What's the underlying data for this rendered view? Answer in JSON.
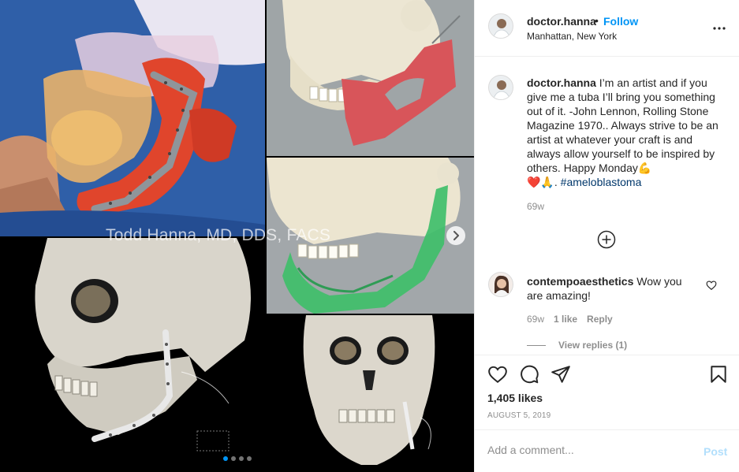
{
  "post": {
    "watermark": "Todd Hanna, MD, DDS, FACS",
    "carousel": {
      "slides": 4,
      "active": 1
    }
  },
  "header": {
    "username": "doctor.hanna",
    "separator": "•",
    "follow_label": "Follow",
    "location": "Manhattan, New York",
    "more_icon": "more-horizontal-icon"
  },
  "caption": {
    "username": "doctor.hanna",
    "text": " I’m an artist and if you give me a tuba I’ll bring you something out of it. -John Lennon, Rolling Stone Magazine 1970.. Always strive to be an artist at whatever your craft is and always allow yourself to be inspired by others. Happy Monday💪",
    "emoji_line": "❤️🙏. ",
    "hashtag": "#ameloblastoma",
    "time": "69w"
  },
  "comments": [
    {
      "username": "contempoaesthetics",
      "text": " Wow you are amazing!",
      "time": "69w",
      "likes": "1 like",
      "reply_label": "Reply",
      "view_replies": "View replies (1)"
    }
  ],
  "actions": {
    "like_icon": "heart-icon",
    "comment_icon": "comment-icon",
    "share_icon": "share-icon",
    "save_icon": "bookmark-icon",
    "likes": "1,405 likes",
    "date": "AUGUST 5, 2019"
  },
  "add_comment": {
    "placeholder": "Add a comment...",
    "post_label": "Post"
  },
  "colors": {
    "link": "#0095f6",
    "hashtag": "#00376b",
    "muted": "#8e8e8e",
    "post_disabled": "#b2dffc"
  }
}
